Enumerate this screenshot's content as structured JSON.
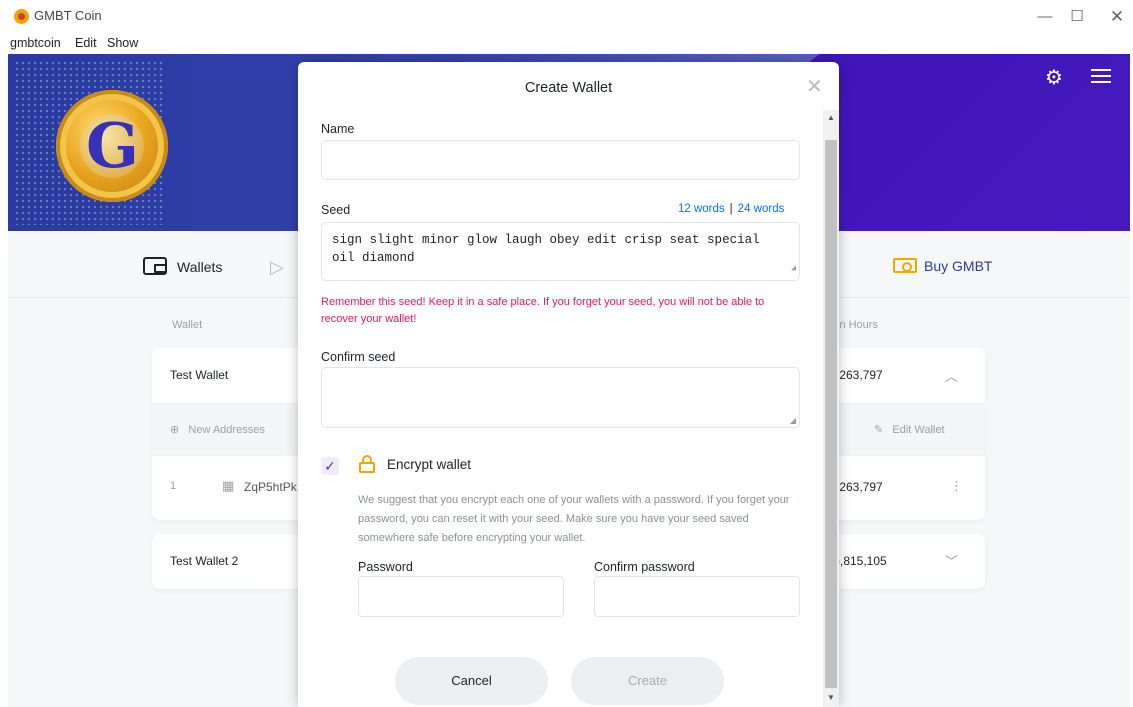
{
  "window": {
    "title": "GMBT Coin",
    "min_glyph": "—",
    "max_glyph": "☐",
    "close_glyph": "✕"
  },
  "menu": [
    "gmbtcoin",
    "Edit",
    "Show"
  ],
  "nav": {
    "wallets": "Wallets",
    "buy": "Buy GMBT"
  },
  "list": {
    "col_wallet": "Wallet",
    "col_hours": "in Hours",
    "wallets": [
      {
        "name": "Test Wallet",
        "hours": ",263,797"
      },
      {
        "name": "Test Wallet 2",
        "hours": "),815,105"
      }
    ],
    "new_addresses": "New Addresses",
    "edit_wallet": "Edit Wallet",
    "address_row": {
      "index": "1",
      "address": "ZqP5htPk",
      "hours": ",263,797"
    }
  },
  "modal": {
    "title": "Create Wallet",
    "name_label": "Name",
    "name_value": "",
    "seed_label": "Seed",
    "seed_12": "12 words",
    "seed_sep": "|",
    "seed_24": "24 words",
    "seed_value": "sign slight minor glow laugh obey edit crisp seat special oil diamond",
    "warning": "Remember this seed! Keep it in a safe place. If you forget your seed, you will not be able to recover your wallet!",
    "confirm_seed_label": "Confirm seed",
    "confirm_seed_value": "",
    "encrypt_checked": true,
    "encrypt_label": "Encrypt wallet",
    "encrypt_desc": "We suggest that you encrypt each one of your wallets with a password. If you forget your password, you can reset it with your seed. Make sure you have your seed saved somewhere safe before encrypting your wallet.",
    "password_label": "Password",
    "confirm_password_label": "Confirm password",
    "cancel": "Cancel",
    "create": "Create"
  },
  "colors": {
    "accent": "#0072ff",
    "warning": "#e8195f",
    "lock": "#f5a300",
    "header": "#2a3aa0"
  }
}
